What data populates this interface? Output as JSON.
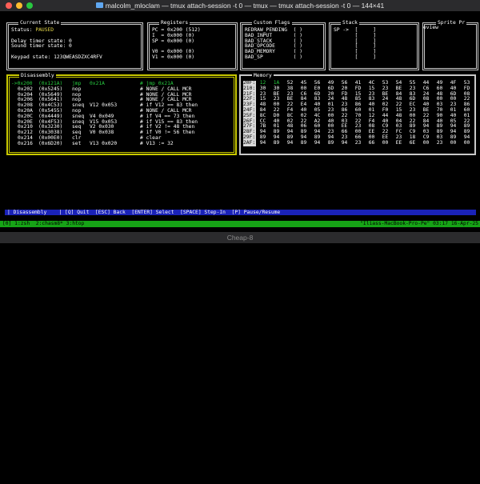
{
  "terminal": {
    "title": "malcolm_mloclam — tmux attach-session -t 0 — tmux — tmux attach-session -t 0 — 144×41"
  },
  "current_state": {
    "title": "Current State",
    "status_label": "Status:",
    "status_value": "PAUSED",
    "delay_timer": "Delay timer state: 0",
    "sound_timer": "Sound timer state: 0",
    "keypad": "Keypad state: 123QWEASDZXC4RFV"
  },
  "registers": {
    "title": "Registers",
    "lines": [
      "PC = 0x200 (512)",
      "I  = 0x000 (0)",
      "SP = 0x000 (0)",
      "",
      "V0 = 0x000 (0)",
      "V1 = 0x000 (0)"
    ]
  },
  "custom_flags": {
    "title": "Custom Flags",
    "lines": [
      "REDRAW_PENDING  ( )",
      "BAD_INPUT       ( )",
      "BAD_STACK       ( )",
      "BAD_OPCODE      ( )",
      "BAD_MEMORY      ( )",
      "BAD_SP          ( )"
    ]
  },
  "stack": {
    "title": "Stack",
    "lines": [
      "SP ->  [     ]",
      "       [     ]",
      "       [     ]",
      "       [     ]",
      "       [     ]",
      "       [     ]"
    ]
  },
  "sprite": {
    "title": "Sprite Pr",
    "subtitle": "eview"
  },
  "disassembly": {
    "title": "Disassembly",
    "current": {
      "addr": "->0x200",
      "code": "(0x121A)",
      "mnemonic": "jmp",
      "args": "0x21A",
      "comment": "# jmp 0x21A"
    },
    "rows": [
      {
        "addr": "0x202",
        "code": "(0x5245)",
        "mnemonic": "nop",
        "args": "",
        "comment": "# NONE / CALL MCR"
      },
      {
        "addr": "0x204",
        "code": "(0x5649)",
        "mnemonic": "nop",
        "args": "",
        "comment": "# NONE / CALL MCR"
      },
      {
        "addr": "0x206",
        "code": "(0x5641)",
        "mnemonic": "nop",
        "args": "",
        "comment": "# NONE / CALL MCR"
      },
      {
        "addr": "0x208",
        "code": "(0x4C53)",
        "mnemonic": "sneq",
        "args": "V12 0x053",
        "comment": "# if V12 == 83 then"
      },
      {
        "addr": "0x20A",
        "code": "(0x5455)",
        "mnemonic": "nop",
        "args": "",
        "comment": "# NONE / CALL MCR"
      },
      {
        "addr": "0x20C",
        "code": "(0x4449)",
        "mnemonic": "sneq",
        "args": "V4 0x049",
        "comment": "# if V4 == 73 then"
      },
      {
        "addr": "0x20E",
        "code": "(0x4F53)",
        "mnemonic": "sneq",
        "args": "V15 0x053",
        "comment": "# if V15 == 83 then"
      },
      {
        "addr": "0x210",
        "code": "(0x3230)",
        "mnemonic": "seq",
        "args": "V2 0x030",
        "comment": "# if V2 != 48 then"
      },
      {
        "addr": "0x212",
        "code": "(0x3038)",
        "mnemonic": "seq",
        "args": "V0 0x038",
        "comment": "# if V0 != 56 then"
      },
      {
        "addr": "0x214",
        "code": "(0x00E0)",
        "mnemonic": "clr",
        "args": "",
        "comment": "# clear"
      },
      {
        "addr": "0x216",
        "code": "(0x6D20)",
        "mnemonic": "set",
        "args": "V13 0x020",
        "comment": "# V13 := 32"
      }
    ]
  },
  "memory": {
    "title": "Memory",
    "header": [
      "12",
      "1A",
      "52",
      "45",
      "56",
      "49",
      "56",
      "41",
      "4C",
      "53",
      "54",
      "55",
      "44",
      "49",
      "4F",
      "53"
    ],
    "rows": [
      {
        "addr": "20F:",
        "bytes": [
          "12",
          "1A",
          "52",
          "45",
          "56",
          "49",
          "56",
          "41",
          "4C",
          "53",
          "54",
          "55",
          "44",
          "49",
          "4F",
          "53"
        ]
      },
      {
        "addr": "210:",
        "bytes": [
          "30",
          "30",
          "38",
          "00",
          "E0",
          "6D",
          "20",
          "FD",
          "15",
          "23",
          "BE",
          "23",
          "C6",
          "60",
          "40",
          "FD"
        ]
      },
      {
        "addr": "21F:",
        "bytes": [
          "23",
          "BE",
          "23",
          "C6",
          "6D",
          "20",
          "FD",
          "15",
          "23",
          "BE",
          "84",
          "83",
          "24",
          "48",
          "6D",
          "08"
        ]
      },
      {
        "addr": "22F:",
        "bytes": [
          "15",
          "23",
          "BE",
          "84",
          "83",
          "24",
          "48",
          "85",
          "83",
          "24",
          "48",
          "6D",
          "08",
          "00",
          "00",
          "22"
        ]
      },
      {
        "addr": "23F:",
        "bytes": [
          "48",
          "00",
          "22",
          "E4",
          "40",
          "01",
          "23",
          "86",
          "40",
          "02",
          "22",
          "EC",
          "40",
          "03",
          "23",
          "86"
        ]
      },
      {
        "addr": "24F:",
        "bytes": [
          "84",
          "22",
          "F4",
          "40",
          "05",
          "23",
          "86",
          "60",
          "01",
          "F0",
          "15",
          "23",
          "BE",
          "70",
          "01",
          "60"
        ]
      },
      {
        "addr": "25F:",
        "bytes": [
          "8C",
          "D0",
          "8C",
          "02",
          "4C",
          "00",
          "22",
          "70",
          "12",
          "44",
          "48",
          "00",
          "22",
          "90",
          "40",
          "01"
        ]
      },
      {
        "addr": "26F:",
        "bytes": [
          "CC",
          "40",
          "02",
          "22",
          "A2",
          "40",
          "03",
          "22",
          "F4",
          "40",
          "04",
          "22",
          "84",
          "40",
          "05",
          "22"
        ]
      },
      {
        "addr": "27F:",
        "bytes": [
          "7B",
          "01",
          "48",
          "06",
          "60",
          "00",
          "EE",
          "23",
          "08",
          "C9",
          "03",
          "89",
          "94",
          "89",
          "94",
          "89"
        ]
      },
      {
        "addr": "28F:",
        "bytes": [
          "94",
          "89",
          "94",
          "89",
          "94",
          "23",
          "66",
          "00",
          "EE",
          "22",
          "FC",
          "C9",
          "03",
          "89",
          "94",
          "89"
        ]
      },
      {
        "addr": "29F:",
        "bytes": [
          "89",
          "94",
          "89",
          "94",
          "89",
          "94",
          "23",
          "66",
          "00",
          "EE",
          "23",
          "18",
          "C9",
          "03",
          "89",
          "94"
        ]
      },
      {
        "addr": "2AF:",
        "bytes": [
          "94",
          "89",
          "94",
          "89",
          "94",
          "89",
          "94",
          "23",
          "66",
          "00",
          "EE",
          "6E",
          "00",
          "23",
          "00",
          "00"
        ]
      }
    ]
  },
  "help_bar": "| Disassembly    | [Q] Quit  [ESC] Back  [ENTER] Select  [SPACE] Step-In  [P] Pause/Resume",
  "status_bar": {
    "left": "[0] 1:zsh  2:chasm8* 3:htop",
    "right": "\"Iliass-MacBook-Pro-Pe\" 03:17 16-Apr-25"
  },
  "game_window": {
    "title": "Cheap-8"
  }
}
